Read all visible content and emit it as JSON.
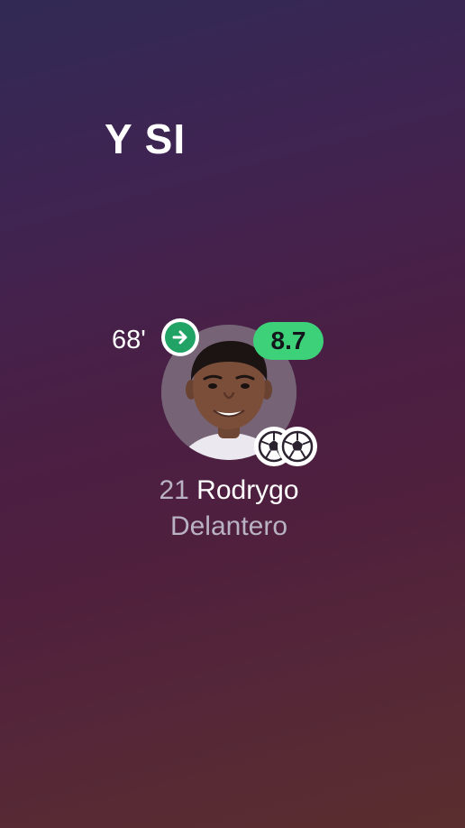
{
  "headline": "Y SI",
  "player": {
    "sub_minute": "68'",
    "sub_icon": "arrow-right-icon",
    "rating": "8.7",
    "number": "21",
    "name": "Rodrygo",
    "position": "Delantero",
    "goals_icon": "soccer-ball-icon",
    "goals": 2
  },
  "colors": {
    "rating_bg": "#3dd17a",
    "sub_icon_bg": "#21a366",
    "muted_text": "#b9b2c3"
  }
}
